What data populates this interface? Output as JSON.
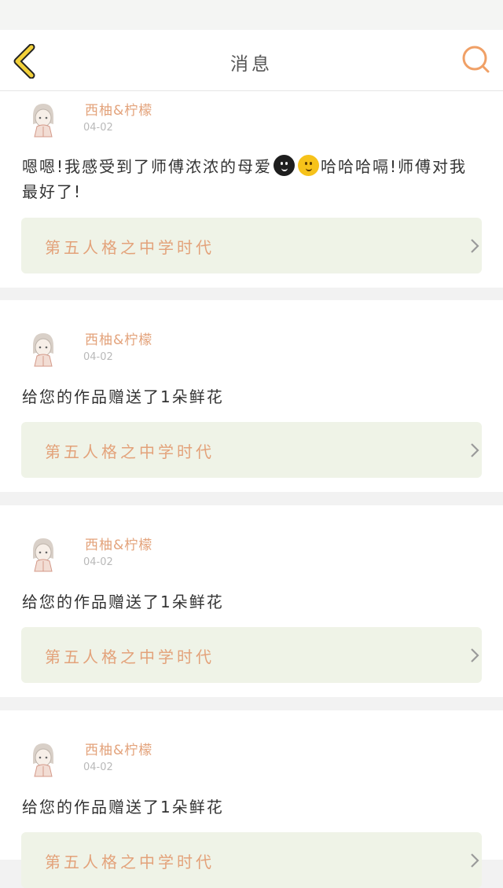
{
  "header": {
    "title": "消息",
    "back_icon": "chevron-left-icon",
    "search_icon": "search-icon"
  },
  "colors": {
    "accent_orange": "#e3a27a",
    "back_yellow": "#f3d13a",
    "link_bg": "#eff3e7"
  },
  "messages": [
    {
      "username": "西柚&柠檬",
      "date": "04-02",
      "text_before": "嗯嗯!我感受到了师傅浓浓的母爱",
      "emojis": [
        "dark-smiley-emoji",
        "yellow-smiley-emoji"
      ],
      "text_after": "哈哈哈嗝!师傅对我最好了!",
      "link_title": "第五人格之中学时代"
    },
    {
      "username": "西柚&柠檬",
      "date": "04-02",
      "text": "给您的作品赠送了1朵鲜花",
      "link_title": "第五人格之中学时代"
    },
    {
      "username": "西柚&柠檬",
      "date": "04-02",
      "text": "给您的作品赠送了1朵鲜花",
      "link_title": "第五人格之中学时代"
    },
    {
      "username": "西柚&柠檬",
      "date": "04-02",
      "text": "给您的作品赠送了1朵鲜花",
      "link_title": "第五人格之中学时代"
    }
  ]
}
